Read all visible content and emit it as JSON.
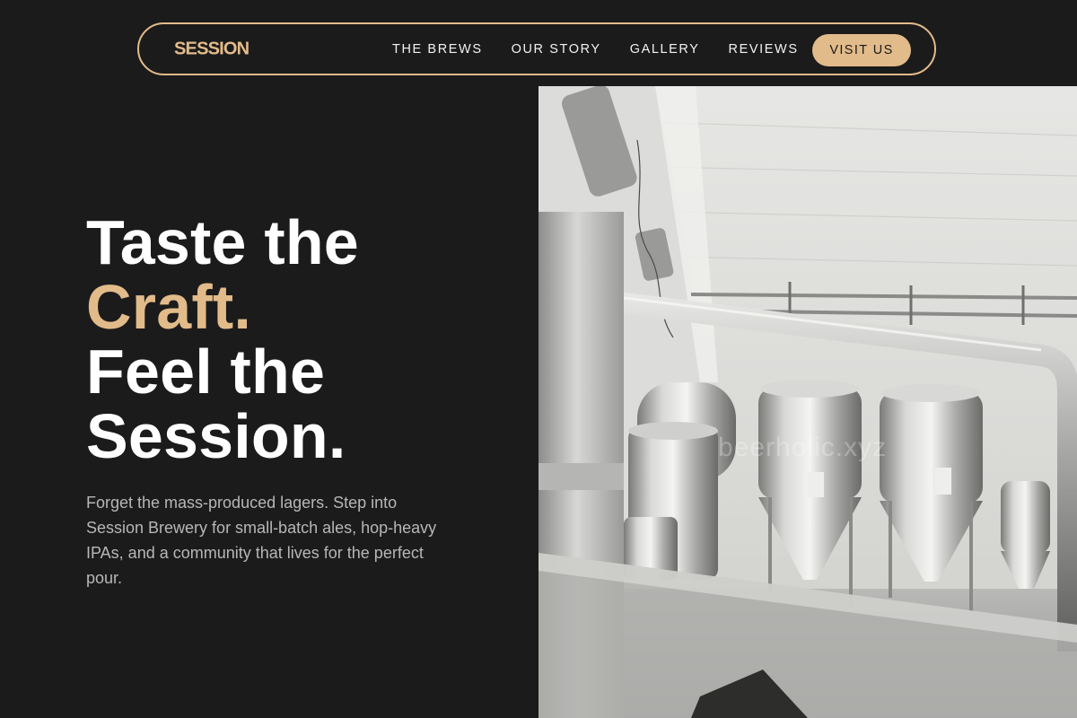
{
  "brand": {
    "logo_text": "SESSION",
    "accent_color": "#e2bb8a",
    "background_color": "#1b1b1b"
  },
  "nav": {
    "links": [
      "THE BREWS",
      "OUR STORY",
      "GALLERY",
      "REVIEWS"
    ],
    "cta_label": "VISIT US"
  },
  "hero": {
    "title_line1": "Taste the",
    "title_accent": "Craft.",
    "title_line3": "Feel the",
    "title_line4": "Session.",
    "description": "Forget the mass-produced lagers. Step into Session Brewery for small-batch ales, hop-heavy IPAs, and a community that lives for the perfect pour.",
    "image": {
      "subject": "brewery-interior-with-steel-fermentation-tanks",
      "watermark_text": "beerholic.xyz"
    }
  }
}
